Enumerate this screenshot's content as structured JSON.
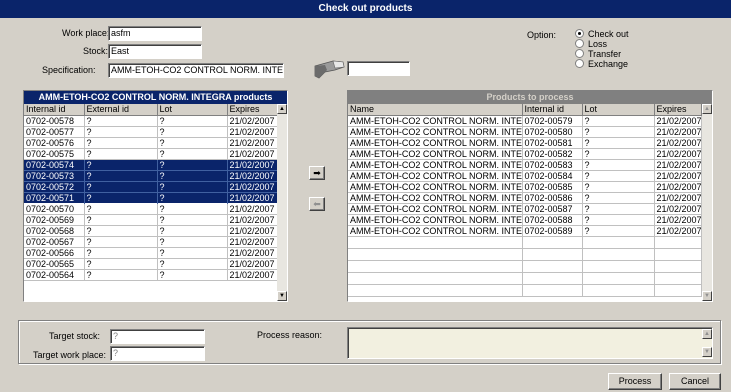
{
  "window": {
    "title": "Check out products"
  },
  "form": {
    "work_place_label": "Work place:",
    "work_place_value": "asfm",
    "stock_label": "Stock:",
    "stock_value": "East",
    "specification_label": "Specification:",
    "specification_value": "AMM-ETOH-CO2 CONTROL NORM. INTEGRA",
    "barcode_value": ""
  },
  "option": {
    "label": "Option:",
    "items": [
      {
        "label": "Check out",
        "selected": true
      },
      {
        "label": "Loss",
        "selected": false
      },
      {
        "label": "Transfer",
        "selected": false
      },
      {
        "label": "Exchange",
        "selected": false
      }
    ]
  },
  "left_grid": {
    "title": "AMM-ETOH-CO2 CONTROL NORM. INTEGRA products",
    "columns": [
      "Internal id",
      "External id",
      "Lot",
      "Expires"
    ],
    "rows": [
      {
        "cells": [
          "0702-00578",
          "?",
          "?",
          "21/02/2007"
        ],
        "selected": false
      },
      {
        "cells": [
          "0702-00577",
          "?",
          "?",
          "21/02/2007"
        ],
        "selected": false
      },
      {
        "cells": [
          "0702-00576",
          "?",
          "?",
          "21/02/2007"
        ],
        "selected": false
      },
      {
        "cells": [
          "0702-00575",
          "?",
          "?",
          "21/02/2007"
        ],
        "selected": false
      },
      {
        "cells": [
          "0702-00574",
          "?",
          "?",
          "21/02/2007"
        ],
        "selected": true
      },
      {
        "cells": [
          "0702-00573",
          "?",
          "?",
          "21/02/2007"
        ],
        "selected": true
      },
      {
        "cells": [
          "0702-00572",
          "?",
          "?",
          "21/02/2007"
        ],
        "selected": true
      },
      {
        "cells": [
          "0702-00571",
          "?",
          "?",
          "21/02/2007"
        ],
        "selected": true,
        "focused": true
      },
      {
        "cells": [
          "0702-00570",
          "?",
          "?",
          "21/02/2007"
        ],
        "selected": false
      },
      {
        "cells": [
          "0702-00569",
          "?",
          "?",
          "21/02/2007"
        ],
        "selected": false
      },
      {
        "cells": [
          "0702-00568",
          "?",
          "?",
          "21/02/2007"
        ],
        "selected": false
      },
      {
        "cells": [
          "0702-00567",
          "?",
          "?",
          "21/02/2007"
        ],
        "selected": false
      },
      {
        "cells": [
          "0702-00566",
          "?",
          "?",
          "21/02/2007"
        ],
        "selected": false
      },
      {
        "cells": [
          "0702-00565",
          "?",
          "?",
          "21/02/2007"
        ],
        "selected": false
      },
      {
        "cells": [
          "0702-00564",
          "?",
          "?",
          "21/02/2007"
        ],
        "selected": false
      }
    ]
  },
  "right_grid": {
    "title": "Products to process",
    "columns": [
      "Name",
      "Internal id",
      "Lot",
      "Expires"
    ],
    "rows": [
      [
        "AMM-ETOH-CO2 CONTROL NORM. INTEGRA",
        "0702-00579",
        "?",
        "21/02/2007"
      ],
      [
        "AMM-ETOH-CO2 CONTROL NORM. INTEGRA",
        "0702-00580",
        "?",
        "21/02/2007"
      ],
      [
        "AMM-ETOH-CO2 CONTROL NORM. INTEGRA",
        "0702-00581",
        "?",
        "21/02/2007"
      ],
      [
        "AMM-ETOH-CO2 CONTROL NORM. INTEGRA",
        "0702-00582",
        "?",
        "21/02/2007"
      ],
      [
        "AMM-ETOH-CO2 CONTROL NORM. INTEGRA",
        "0702-00583",
        "?",
        "21/02/2007"
      ],
      [
        "AMM-ETOH-CO2 CONTROL NORM. INTEGRA",
        "0702-00584",
        "?",
        "21/02/2007"
      ],
      [
        "AMM-ETOH-CO2 CONTROL NORM. INTEGRA",
        "0702-00585",
        "?",
        "21/02/2007"
      ],
      [
        "AMM-ETOH-CO2 CONTROL NORM. INTEGRA",
        "0702-00586",
        "?",
        "21/02/2007"
      ],
      [
        "AMM-ETOH-CO2 CONTROL NORM. INTEGRA",
        "0702-00587",
        "?",
        "21/02/2007"
      ],
      [
        "AMM-ETOH-CO2 CONTROL NORM. INTEGRA",
        "0702-00588",
        "?",
        "21/02/2007"
      ],
      [
        "AMM-ETOH-CO2 CONTROL NORM. INTEGRA",
        "0702-00589",
        "?",
        "21/02/2007"
      ]
    ],
    "empty_rows": 5
  },
  "transfer": {
    "target_stock_label": "Target stock:",
    "target_stock_value": "?",
    "target_work_place_label": "Target work place:",
    "target_work_place_value": "?",
    "process_reason_label": "Process reason:",
    "process_reason_value": ""
  },
  "buttons": {
    "process": "Process",
    "cancel": "Cancel"
  },
  "icons": {
    "move_right": "arrow-right-icon",
    "move_left": "arrow-left-icon",
    "scanner": "barcode-scanner-icon"
  },
  "colors": {
    "title_bar": "#0a246a",
    "selection": "#0a246a",
    "face": "#d4d0c8",
    "reason_bg": "#f2f0e0"
  }
}
